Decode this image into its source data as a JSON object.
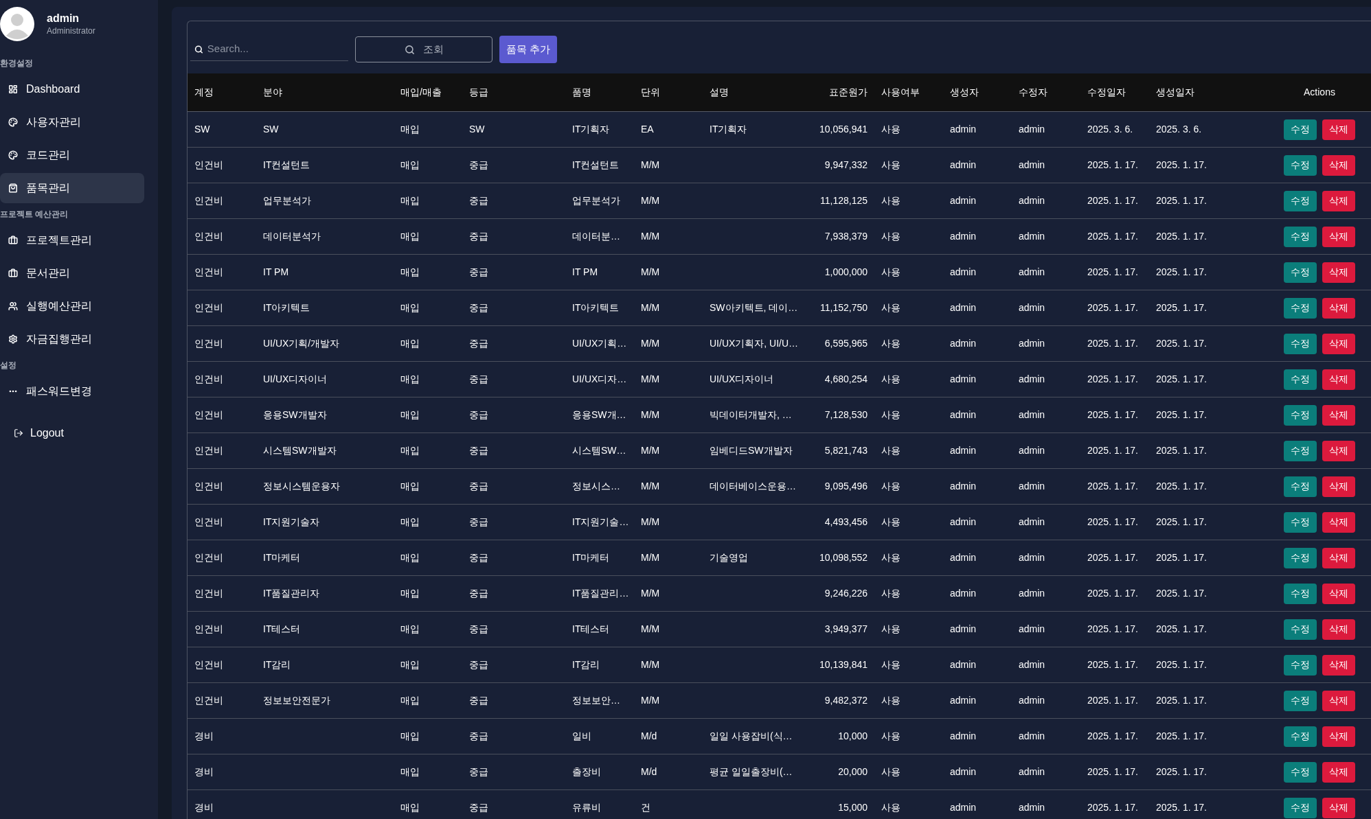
{
  "sidebar": {
    "user": {
      "name": "admin",
      "role": "Administrator"
    },
    "sections": [
      {
        "title": "환경설정",
        "items": [
          {
            "label": "Dashboard",
            "selected": false
          },
          {
            "label": "사용자관리",
            "selected": false
          },
          {
            "label": "코드관리",
            "selected": false
          },
          {
            "label": "품목관리",
            "selected": true
          }
        ]
      },
      {
        "title": "프로젝트 예산관리",
        "items": [
          {
            "label": "프로젝트관리",
            "selected": false
          },
          {
            "label": "문서관리",
            "selected": false
          },
          {
            "label": "실행예산관리",
            "selected": false
          },
          {
            "label": "자금집행관리",
            "selected": false
          }
        ]
      },
      {
        "title": "설정",
        "items": [
          {
            "label": "패스워드변경",
            "selected": false
          }
        ]
      }
    ],
    "logout": "Logout"
  },
  "toolbar": {
    "search": {
      "placeholder": "Search..."
    },
    "query_button": "조회",
    "add_button": "품목 추가"
  },
  "table": {
    "columns": [
      "계정",
      "분야",
      "매입/매출",
      "등급",
      "품명",
      "단위",
      "설명",
      "표준원가",
      "사용여부",
      "생성자",
      "수정자",
      "수정일자",
      "생성일자",
      "Actions"
    ],
    "rows": [
      {
        "account": "SW",
        "category": "SW",
        "trade": "매입",
        "grade": "SW",
        "item": "IT기획자",
        "unit": "EA",
        "description": "IT기획자",
        "cost": "10,056,941",
        "use": "사용",
        "created_by": "admin",
        "modified_by": "admin",
        "modified_at": "2025. 3. 6.",
        "created_at": "2025. 3. 6.",
        "edit": "수정",
        "delete": "삭제"
      },
      {
        "account": "인건비",
        "category": "IT컨설턴트",
        "trade": "매입",
        "grade": "중급",
        "item": "IT컨설턴트",
        "unit": "M/M",
        "cost": "9,947,332",
        "use": "사용",
        "created_by": "admin",
        "modified_by": "admin",
        "modified_at": "2025. 1. 17.",
        "created_at": "2025. 1. 17.",
        "edit": "수정",
        "delete": "삭제"
      },
      {
        "account": "인건비",
        "category": "업무분석가",
        "trade": "매입",
        "grade": "중급",
        "item": "업무분석가",
        "unit": "M/M",
        "cost": "11,128,125",
        "use": "사용",
        "created_by": "admin",
        "modified_by": "admin",
        "modified_at": "2025. 1. 17.",
        "created_at": "2025. 1. 17.",
        "edit": "수정",
        "delete": "삭제"
      },
      {
        "account": "인건비",
        "category": "데이터분석가",
        "trade": "매입",
        "grade": "중급",
        "item": "데이터분…",
        "unit": "M/M",
        "cost": "7,938,379",
        "use": "사용",
        "created_by": "admin",
        "modified_by": "admin",
        "modified_at": "2025. 1. 17.",
        "created_at": "2025. 1. 17.",
        "edit": "수정",
        "delete": "삭제"
      },
      {
        "account": "인건비",
        "category": "IT PM",
        "trade": "매입",
        "grade": "중급",
        "item": "IT PM",
        "unit": "M/M",
        "cost": "1,000,000",
        "use": "사용",
        "created_by": "admin",
        "modified_by": "admin",
        "modified_at": "2025. 1. 17.",
        "created_at": "2025. 1. 17.",
        "edit": "수정",
        "delete": "삭제"
      },
      {
        "account": "인건비",
        "category": "IT아키텍트",
        "trade": "매입",
        "grade": "중급",
        "item": "IT아키텍트",
        "unit": "M/M",
        "description": "SW아키텍트, 데이…",
        "cost": "11,152,750",
        "use": "사용",
        "created_by": "admin",
        "modified_by": "admin",
        "modified_at": "2025. 1. 17.",
        "created_at": "2025. 1. 17.",
        "edit": "수정",
        "delete": "삭제"
      },
      {
        "account": "인건비",
        "category": "UI/UX기획/개발자",
        "trade": "매입",
        "grade": "중급",
        "item": "UI/UX기획…",
        "unit": "M/M",
        "description": "UI/UX기획자, UI/U…",
        "cost": "6,595,965",
        "use": "사용",
        "created_by": "admin",
        "modified_by": "admin",
        "modified_at": "2025. 1. 17.",
        "created_at": "2025. 1. 17.",
        "edit": "수정",
        "delete": "삭제"
      },
      {
        "account": "인건비",
        "category": "UI/UX디자이너",
        "trade": "매입",
        "grade": "중급",
        "item": "UI/UX디자…",
        "unit": "M/M",
        "description": "UI/UX디자이너",
        "cost": "4,680,254",
        "use": "사용",
        "created_by": "admin",
        "modified_by": "admin",
        "modified_at": "2025. 1. 17.",
        "created_at": "2025. 1. 17.",
        "edit": "수정",
        "delete": "삭제"
      },
      {
        "account": "인건비",
        "category": "응용SW개발자",
        "trade": "매입",
        "grade": "중급",
        "item": "응용SW개…",
        "unit": "M/M",
        "description": "빅데이터개발자, …",
        "cost": "7,128,530",
        "use": "사용",
        "created_by": "admin",
        "modified_by": "admin",
        "modified_at": "2025. 1. 17.",
        "created_at": "2025. 1. 17.",
        "edit": "수정",
        "delete": "삭제"
      },
      {
        "account": "인건비",
        "category": "시스템SW개발자",
        "trade": "매입",
        "grade": "중급",
        "item": "시스템SW…",
        "unit": "M/M",
        "description": "임베디드SW개발자",
        "cost": "5,821,743",
        "use": "사용",
        "created_by": "admin",
        "modified_by": "admin",
        "modified_at": "2025. 1. 17.",
        "created_at": "2025. 1. 17.",
        "edit": "수정",
        "delete": "삭제"
      },
      {
        "account": "인건비",
        "category": "정보시스템운용자",
        "trade": "매입",
        "grade": "중급",
        "item": "정보시스…",
        "unit": "M/M",
        "description": "데이터베이스운용…",
        "cost": "9,095,496",
        "use": "사용",
        "created_by": "admin",
        "modified_by": "admin",
        "modified_at": "2025. 1. 17.",
        "created_at": "2025. 1. 17.",
        "edit": "수정",
        "delete": "삭제"
      },
      {
        "account": "인건비",
        "category": "IT지원기술자",
        "trade": "매입",
        "grade": "중급",
        "item": "IT지원기술…",
        "unit": "M/M",
        "cost": "4,493,456",
        "use": "사용",
        "created_by": "admin",
        "modified_by": "admin",
        "modified_at": "2025. 1. 17.",
        "created_at": "2025. 1. 17.",
        "edit": "수정",
        "delete": "삭제"
      },
      {
        "account": "인건비",
        "category": "IT마케터",
        "trade": "매입",
        "grade": "중급",
        "item": "IT마케터",
        "unit": "M/M",
        "description": "기술영업",
        "cost": "10,098,552",
        "use": "사용",
        "created_by": "admin",
        "modified_by": "admin",
        "modified_at": "2025. 1. 17.",
        "created_at": "2025. 1. 17.",
        "edit": "수정",
        "delete": "삭제"
      },
      {
        "account": "인건비",
        "category": "IT품질관리자",
        "trade": "매입",
        "grade": "중급",
        "item": "IT품질관리…",
        "unit": "M/M",
        "cost": "9,246,226",
        "use": "사용",
        "created_by": "admin",
        "modified_by": "admin",
        "modified_at": "2025. 1. 17.",
        "created_at": "2025. 1. 17.",
        "edit": "수정",
        "delete": "삭제"
      },
      {
        "account": "인건비",
        "category": "IT테스터",
        "trade": "매입",
        "grade": "중급",
        "item": "IT테스터",
        "unit": "M/M",
        "cost": "3,949,377",
        "use": "사용",
        "created_by": "admin",
        "modified_by": "admin",
        "modified_at": "2025. 1. 17.",
        "created_at": "2025. 1. 17.",
        "edit": "수정",
        "delete": "삭제"
      },
      {
        "account": "인건비",
        "category": "IT감리",
        "trade": "매입",
        "grade": "중급",
        "item": "IT감리",
        "unit": "M/M",
        "cost": "10,139,841",
        "use": "사용",
        "created_by": "admin",
        "modified_by": "admin",
        "modified_at": "2025. 1. 17.",
        "created_at": "2025. 1. 17.",
        "edit": "수정",
        "delete": "삭제"
      },
      {
        "account": "인건비",
        "category": "정보보안전문가",
        "trade": "매입",
        "grade": "중급",
        "item": "정보보안…",
        "unit": "M/M",
        "cost": "9,482,372",
        "use": "사용",
        "created_by": "admin",
        "modified_by": "admin",
        "modified_at": "2025. 1. 17.",
        "created_at": "2025. 1. 17.",
        "edit": "수정",
        "delete": "삭제"
      },
      {
        "account": "경비",
        "trade": "매입",
        "grade": "중급",
        "item": "일비",
        "unit": "M/d",
        "description": "일일 사용잡비(식…",
        "cost": "10,000",
        "use": "사용",
        "created_by": "admin",
        "modified_by": "admin",
        "modified_at": "2025. 1. 17.",
        "created_at": "2025. 1. 17.",
        "edit": "수정",
        "delete": "삭제"
      },
      {
        "account": "경비",
        "trade": "매입",
        "grade": "중급",
        "item": "출장비",
        "unit": "M/d",
        "description": "평균 일일출장비(…",
        "cost": "20,000",
        "use": "사용",
        "created_by": "admin",
        "modified_by": "admin",
        "modified_at": "2025. 1. 17.",
        "created_at": "2025. 1. 17.",
        "edit": "수정",
        "delete": "삭제"
      },
      {
        "account": "경비",
        "trade": "매입",
        "grade": "중급",
        "item": "유류비",
        "unit": "건",
        "cost": "15,000",
        "use": "사용",
        "created_by": "admin",
        "modified_by": "admin",
        "modified_at": "2025. 1. 17.",
        "created_at": "2025. 1. 17.",
        "edit": "수정",
        "delete": "삭제"
      }
    ]
  }
}
